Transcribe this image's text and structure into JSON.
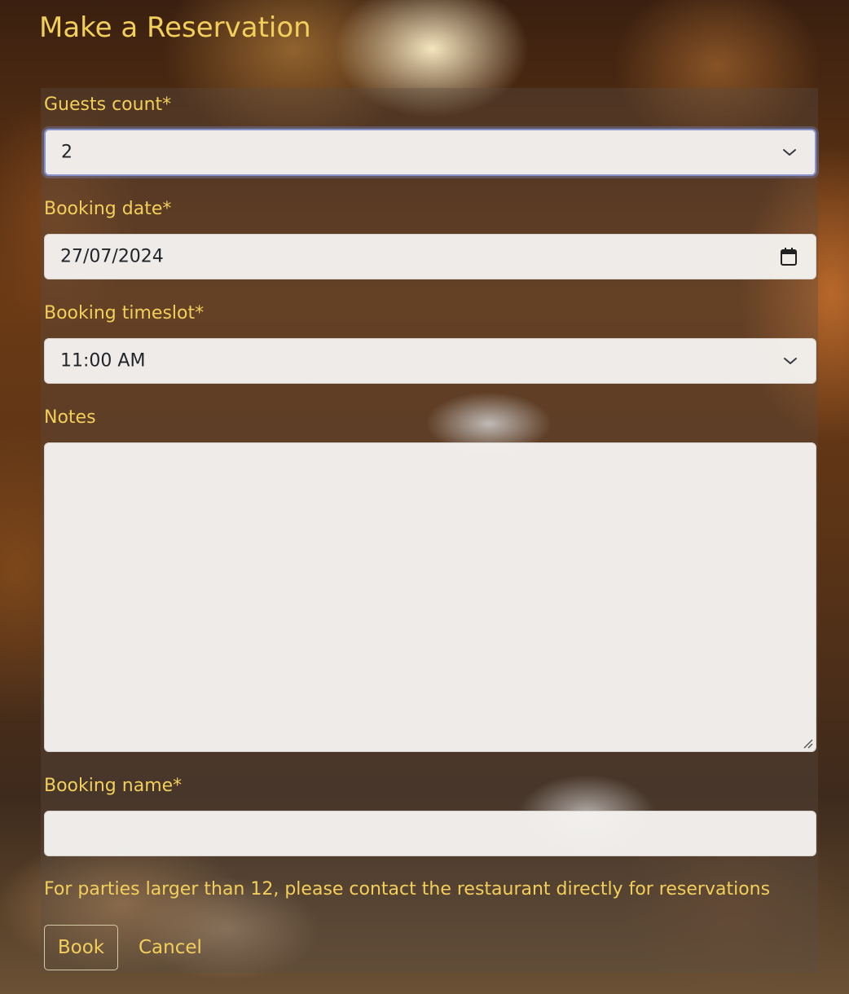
{
  "page": {
    "title": "Make a Reservation"
  },
  "form": {
    "guests": {
      "label": "Guests count*",
      "value": "2"
    },
    "date": {
      "label": "Booking date*",
      "value": "27/07/2024"
    },
    "timeslot": {
      "label": "Booking timeslot*",
      "value": "11:00 AM"
    },
    "notes": {
      "label": "Notes",
      "value": ""
    },
    "name": {
      "label": "Booking name*",
      "value": ""
    },
    "info": "For parties larger than 12, please contact the restaurant directly for reservations"
  },
  "actions": {
    "book_label": "Book",
    "cancel_label": "Cancel"
  },
  "colors": {
    "accent_text": "#f2cf5b",
    "field_background": "#f5f2f0",
    "focus_border": "#8794c9"
  },
  "icons": {
    "select_chevron": "chevron-down-icon",
    "date_picker": "calendar-icon",
    "textarea_resize": "resize-handle-icon"
  }
}
